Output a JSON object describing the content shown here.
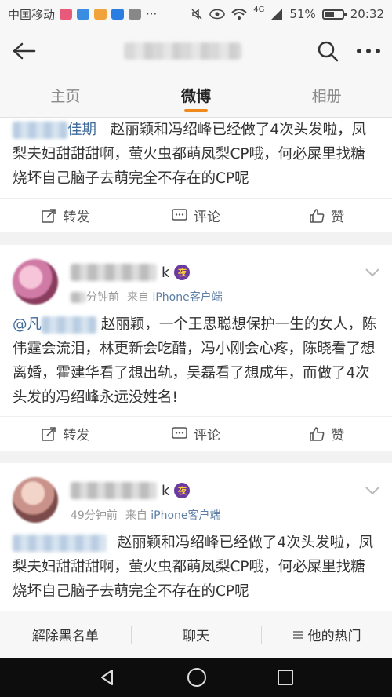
{
  "status_bar": {
    "carrier": "中国移动",
    "network": "4G",
    "battery": "51%",
    "time": "20:32"
  },
  "tabs": [
    {
      "label": "主页"
    },
    {
      "label": "微博"
    },
    {
      "label": "相册"
    }
  ],
  "posts": [
    {
      "mention_visible": "佳期",
      "text": "赵丽颖和冯绍峰已经做了4次头发啦，凤梨夫妇甜甜甜啊，萤火虫都萌凤梨CP哦，何必屎里找糖烧坏自己脑子去萌完全不存在的CP呢",
      "actions": {
        "repost": "转发",
        "comment": "评论",
        "like": "赞"
      }
    },
    {
      "name_suffix": "k",
      "vip_label": "夜",
      "time": "分钟前",
      "source": "来自 iPhone客户端",
      "source_prefix": "来自",
      "source_device": "iPhone客户端",
      "mention_visible": "@凡",
      "text": "赵丽颖，一个王思聪想保护一生的女人，陈伟霆会流泪，林更新会吃醋，冯小刚会心疼，陈晓看了想离婚，霍建华看了想出轨，吴磊看了想成年，而做了4次头发的冯绍峰永远没姓名!",
      "actions": {
        "repost": "转发",
        "comment": "评论",
        "like": "赞"
      }
    },
    {
      "name_suffix": "k",
      "vip_label": "夜",
      "time": "49分钟前",
      "source_prefix": "来自",
      "source_device": "iPhone客户端",
      "text": "赵丽颖和冯绍峰已经做了4次头发啦，凤梨夫妇甜甜甜啊，萤火虫都萌凤梨CP哦，何必屎里找糖烧坏自己脑子去萌完全不存在的CP呢"
    }
  ],
  "bottom_bar": {
    "unblock": "解除黑名单",
    "chat": "聊天",
    "hot": "他的热门"
  },
  "colors": {
    "accent": "#f08a1c",
    "link": "#3f6a9a",
    "vip": "#6a3aa0"
  }
}
